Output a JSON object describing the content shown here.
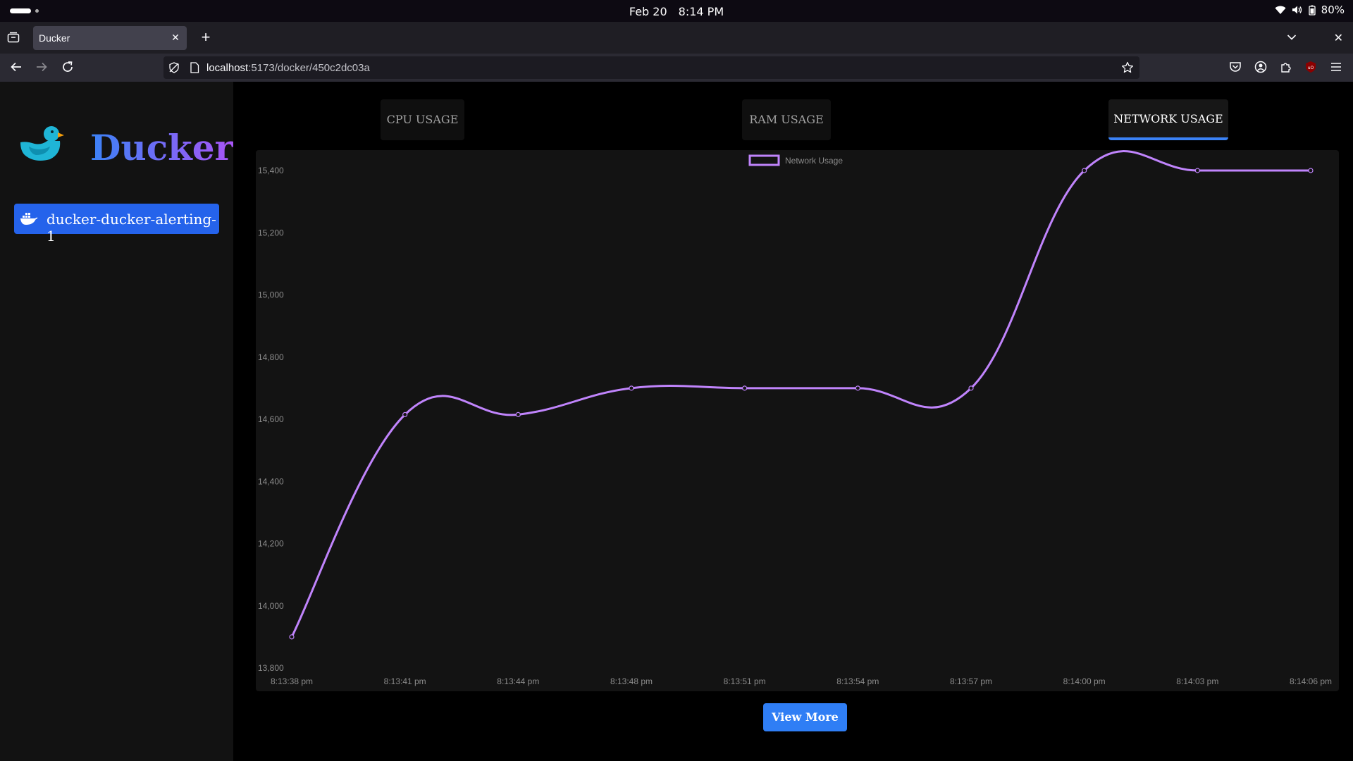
{
  "os": {
    "date": "Feb 20",
    "time": "8:14 PM",
    "battery": "80%"
  },
  "browser": {
    "tab_title": "Ducker",
    "url_host": "localhost",
    "url_rest": ":5173/docker/450c2dc03a"
  },
  "sidebar": {
    "brand": "Ducker",
    "containers": [
      {
        "name": "ducker-ducker-alerting-1"
      }
    ]
  },
  "main": {
    "tabs": [
      {
        "label": "CPU USAGE"
      },
      {
        "label": "RAM USAGE"
      },
      {
        "label": "NETWORK USAGE"
      }
    ],
    "active_tab": "NETWORK USAGE",
    "view_more_label": "View More"
  },
  "colors": {
    "accent": "#2563eb",
    "line": "#c084fc"
  },
  "chart_data": {
    "type": "line",
    "title": "",
    "xlabel": "",
    "ylabel": "",
    "legend": "top-center",
    "grid": false,
    "ylim": [
      13800,
      15400
    ],
    "yticks": [
      "15,400",
      "15,200",
      "15,000",
      "14,800",
      "14,600",
      "14,400",
      "14,200",
      "14,000",
      "13,800"
    ],
    "x": [
      "8:13:38 pm",
      "8:13:41 pm",
      "8:13:44 pm",
      "8:13:48 pm",
      "8:13:51 pm",
      "8:13:54 pm",
      "8:13:57 pm",
      "8:14:00 pm",
      "8:14:03 pm",
      "8:14:06 pm"
    ],
    "series": [
      {
        "name": "Network Usage",
        "values": [
          13900,
          14615,
          14615,
          14700,
          14700,
          14700,
          14700,
          15400,
          15400,
          15400
        ]
      }
    ]
  }
}
